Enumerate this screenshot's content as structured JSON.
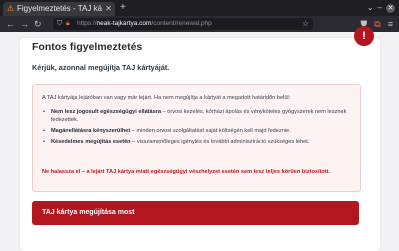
{
  "browser": {
    "tab_title": "Figyelmeztetés - TAJ ká",
    "new_tab": "+",
    "url_host": "neak-tajkartya.com",
    "url_path": "/content/renewal.php",
    "url_scheme": "https://"
  },
  "page": {
    "title": "Fontos figyelmeztetés",
    "lead": "Kérjük, azonnal megújítja TAJ kártyáját.",
    "intro": "A TAJ kártyája lejáróban van vagy már lejárt. Ha nem megújítja a kártyát a megadott határidőn belül:",
    "items": [
      {
        "bold": "Nem lesz jogosult egészségügyi ellátásra",
        "text": " – orvosi kezelés, kórházi ápolás és vényköteles gyógyszerek nem lesznek fedezettek."
      },
      {
        "bold": "Magánellátásra kényszerülhet",
        "text": " – minden orvosi szolgáltatást saját költségén kell majd fedeznie."
      },
      {
        "bold": "Késedelmes megújítás esetén",
        "text": " – visszamenőleges igénylés és további adminisztráció szükséges lehet."
      }
    ],
    "warning": "Ne halassza el – a lejárt TAJ kártya miatt egészségügyi vészhelyzet esetén sem lesz teljes körűen biztosított.",
    "cta": "TAJ kártya megújítása most",
    "fab": "!"
  },
  "colors": {
    "accent": "#b3161e",
    "warning_text": "#c0161f",
    "alert_bg": "#fdf3f3"
  }
}
